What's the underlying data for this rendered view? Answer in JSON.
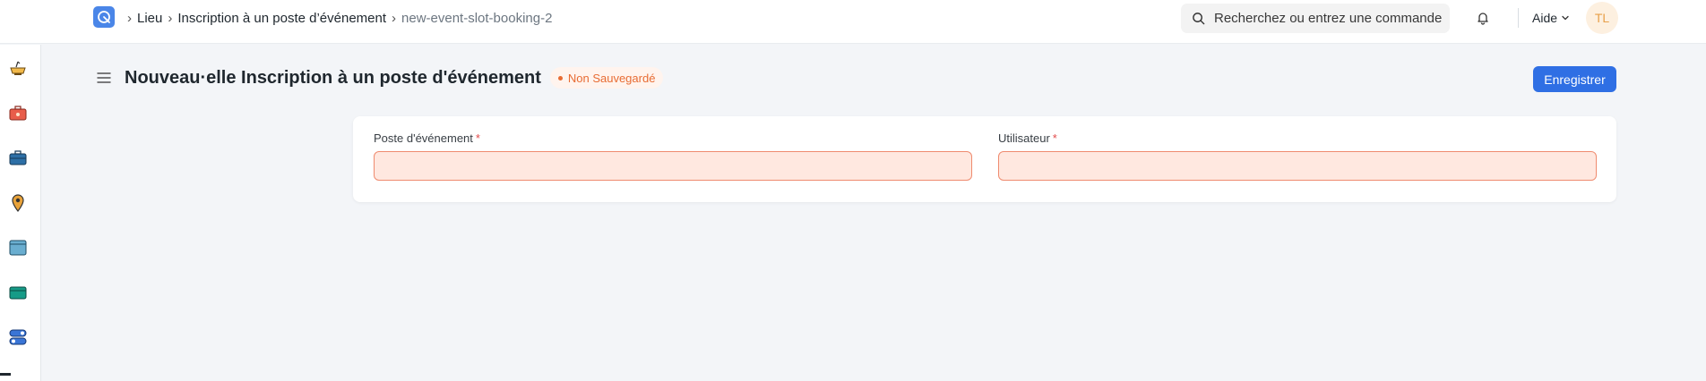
{
  "topbar": {
    "breadcrumbs": [
      {
        "label": "Lieu"
      },
      {
        "label": "Inscription à un poste d’événement"
      },
      {
        "label": "new-event-slot-booking-2"
      }
    ],
    "search_placeholder": "Recherchez ou entrez une commande",
    "help_label": "Aide",
    "avatar_initials": "TL"
  },
  "sidebar": {
    "icons": [
      "bowl-icon",
      "toolbox-icon",
      "briefcase-icon",
      "location-pin-icon",
      "window-icon",
      "card-icon",
      "toggle-icon"
    ]
  },
  "page": {
    "title": "Nouveau·elle Inscription à un poste d'événement",
    "status": "Non Sauvegardé",
    "save_label": "Enregistrer"
  },
  "form": {
    "fields": [
      {
        "label": "Poste d'événement",
        "required_mark": "*",
        "value": ""
      },
      {
        "label": "Utilisateur",
        "required_mark": "*",
        "value": ""
      }
    ]
  },
  "colors": {
    "primary": "#2f6fe4",
    "warning": "#e86c33",
    "required": "#e24c4c",
    "invalid_field_bg": "#ffe8e0"
  }
}
